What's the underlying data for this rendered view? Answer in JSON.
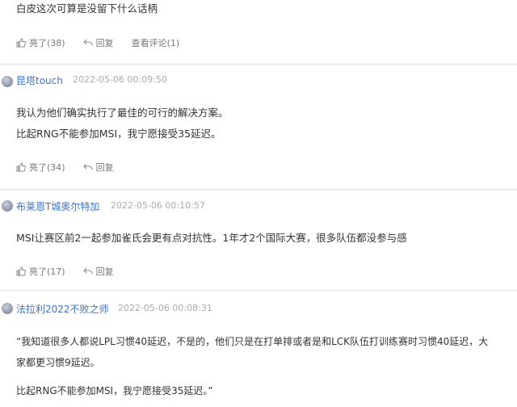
{
  "comments": [
    {
      "id": "c0",
      "username": "",
      "time": "",
      "lines": [
        "白皮这次可算是没留下什么话柄"
      ],
      "like_label": "亮了(38)",
      "reply_label": "回复",
      "view_label": "查看评论(1)"
    },
    {
      "id": "c1",
      "username": "昆塔touch",
      "time": "2022-05-06 00:09:50",
      "lines": [
        "我认为他们确实执行了最佳的可行的解决方案。",
        "比起RNG不能参加MSI，我宁愿接受35延迟。"
      ],
      "like_label": "亮了(34)",
      "reply_label": "回复"
    },
    {
      "id": "c2",
      "username": "布莱恩T城奥尔特加",
      "time": "2022-05-06 00:10:57",
      "lines": [
        "MSI让赛区前2一起参加雀氏会更有点对抗性。1年才2个国际大赛，很多队伍都没参与感"
      ],
      "like_label": "亮了(17)",
      "reply_label": "回复"
    },
    {
      "id": "c3",
      "username": "法拉利2022不败之师",
      "time": "2022-05-06 00:08:31",
      "lines": [
        "“我知道很多人都说LPL习惯40延迟，不是的，他们只是在打单排或者是和LCK队伍打训练赛时习惯40延迟，大",
        "家都更习惯9延迟。",
        "比起RNG不能参加MSI，我宁愿接受35延迟。”"
      ]
    }
  ]
}
